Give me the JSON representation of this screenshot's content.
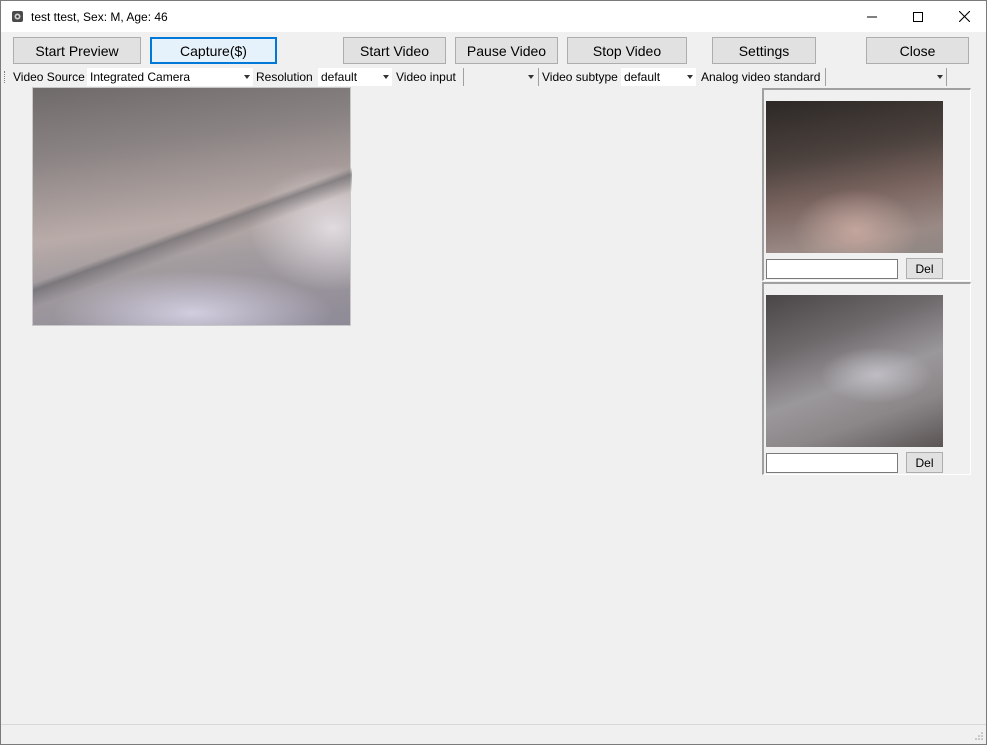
{
  "window": {
    "title": "test ttest, Sex: M, Age: 46"
  },
  "toolbar": {
    "start_preview": "Start Preview",
    "capture": "Capture($)",
    "start_video": "Start Video",
    "pause_video": "Pause Video",
    "stop_video": "Stop Video",
    "settings": "Settings",
    "close": "Close"
  },
  "properties": {
    "video_source_label": "Video Source",
    "video_source_value": "Integrated Camera",
    "resolution_label": "Resolution",
    "resolution_value": "default",
    "video_input_label": "Video input",
    "video_input_value": "",
    "video_subtype_label": "Video subtype",
    "video_subtype_value": "default",
    "analog_standard_label": "Analog video standard",
    "analog_standard_value": ""
  },
  "thumbnails": [
    {
      "note": "",
      "delete_label": "Del"
    },
    {
      "note": "",
      "delete_label": "Del"
    }
  ]
}
